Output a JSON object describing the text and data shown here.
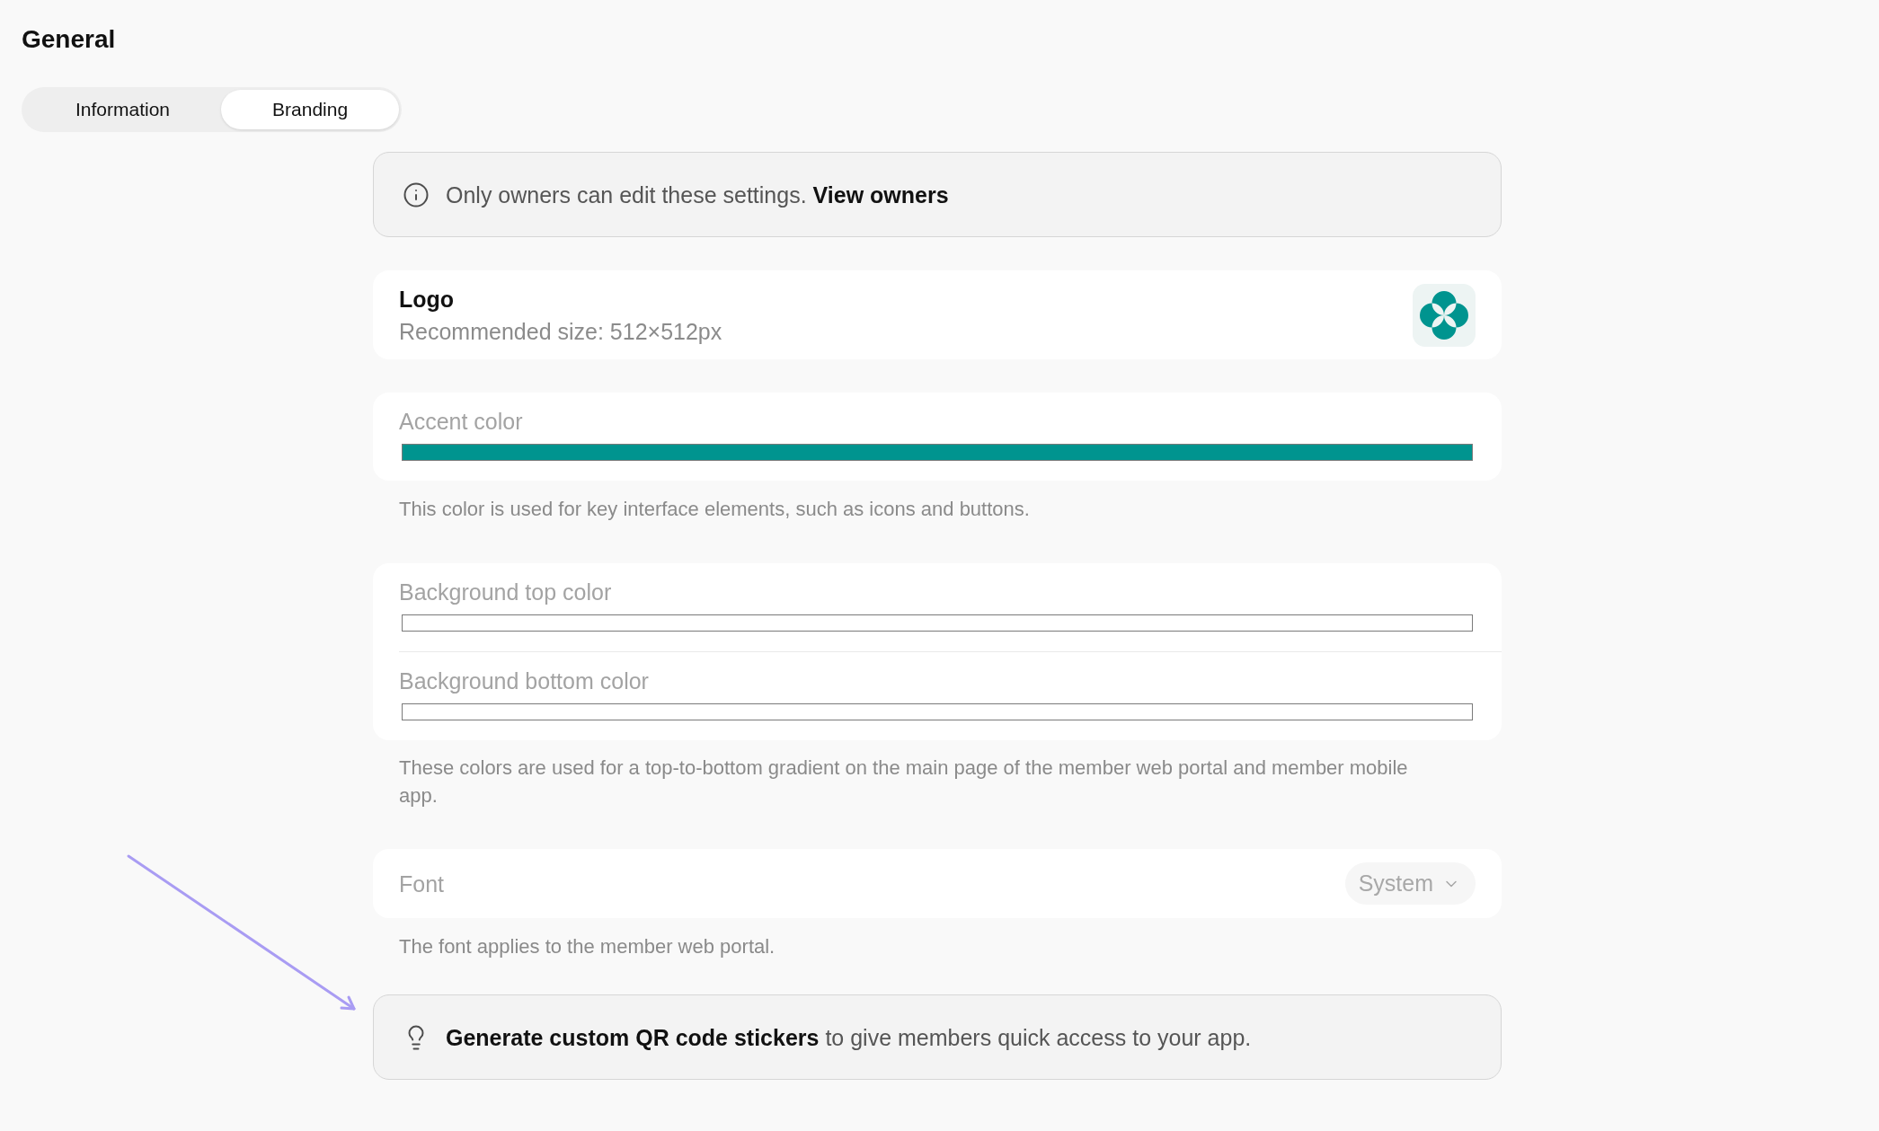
{
  "page": {
    "title": "General"
  },
  "tabs": [
    {
      "label": "Information",
      "selected": false
    },
    {
      "label": "Branding",
      "selected": true
    }
  ],
  "notice": {
    "text": "Only owners can edit these settings.",
    "link": "View owners"
  },
  "logo": {
    "label": "Logo",
    "hint": "Recommended size: 512×512px"
  },
  "color_groups": [
    {
      "fields": [
        {
          "label": "Accent color",
          "color": "#00948f"
        }
      ],
      "description": "This color is used for key interface elements, such as icons and buttons."
    },
    {
      "fields": [
        {
          "label": "Background top color",
          "color": "#ffffff"
        },
        {
          "label": "Background bottom color",
          "color": "#ffffff"
        }
      ],
      "description": "These colors are used for a top-to-bottom gradient on the main page of the member web portal and member mobile app."
    }
  ],
  "font": {
    "label": "Font",
    "value": "System",
    "description": "The font applies to the member web portal."
  },
  "tip": {
    "link": "Generate custom QR code stickers",
    "text": "to give members quick access to your app."
  }
}
